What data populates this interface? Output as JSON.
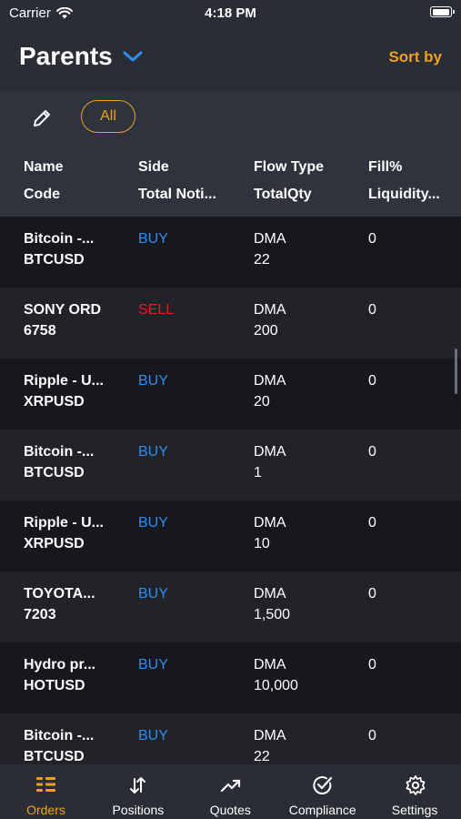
{
  "status": {
    "carrier": "Carrier",
    "time": "4:18 PM",
    "battery": 1.0
  },
  "header": {
    "title": "Parents",
    "sort_label": "Sort by"
  },
  "filter": {
    "chip_label": "All"
  },
  "columns": [
    {
      "top": "Name",
      "bottom": "Code"
    },
    {
      "top": "Side",
      "bottom": "Total Noti..."
    },
    {
      "top": "Flow Type",
      "bottom": "TotalQty"
    },
    {
      "top": "Fill%",
      "bottom": "Liquidity..."
    }
  ],
  "rows": [
    {
      "name": "Bitcoin -...",
      "code": "BTCUSD",
      "side": "BUY",
      "flow": "DMA",
      "qty": "22",
      "fill": "0"
    },
    {
      "name": "SONY ORD",
      "code": "6758",
      "side": "SELL",
      "flow": "DMA",
      "qty": "200",
      "fill": "0"
    },
    {
      "name": "Ripple - U...",
      "code": "XRPUSD",
      "side": "BUY",
      "flow": "DMA",
      "qty": "20",
      "fill": "0"
    },
    {
      "name": "Bitcoin -...",
      "code": "BTCUSD",
      "side": "BUY",
      "flow": "DMA",
      "qty": "1",
      "fill": "0"
    },
    {
      "name": "Ripple - U...",
      "code": "XRPUSD",
      "side": "BUY",
      "flow": "DMA",
      "qty": "10",
      "fill": "0"
    },
    {
      "name": "TOYOTA...",
      "code": "7203",
      "side": "BUY",
      "flow": "DMA",
      "qty": "1,500",
      "fill": "0"
    },
    {
      "name": "Hydro pr...",
      "code": "HOTUSD",
      "side": "BUY",
      "flow": "DMA",
      "qty": "10,000",
      "fill": "0"
    },
    {
      "name": "Bitcoin -...",
      "code": "BTCUSD",
      "side": "BUY",
      "flow": "DMA",
      "qty": "22",
      "fill": "0"
    }
  ],
  "tabs": [
    {
      "label": "Orders",
      "icon": "orders-list-icon",
      "active": true
    },
    {
      "label": "Positions",
      "icon": "sort-arrows-icon",
      "active": false
    },
    {
      "label": "Quotes",
      "icon": "trending-up-icon",
      "active": false
    },
    {
      "label": "Compliance",
      "icon": "check-circle-icon",
      "active": false
    },
    {
      "label": "Settings",
      "icon": "gear-icon",
      "active": false
    }
  ],
  "colors": {
    "accent": "#f0a020",
    "buy": "#2f8cf0",
    "sell": "#e01e1e"
  }
}
